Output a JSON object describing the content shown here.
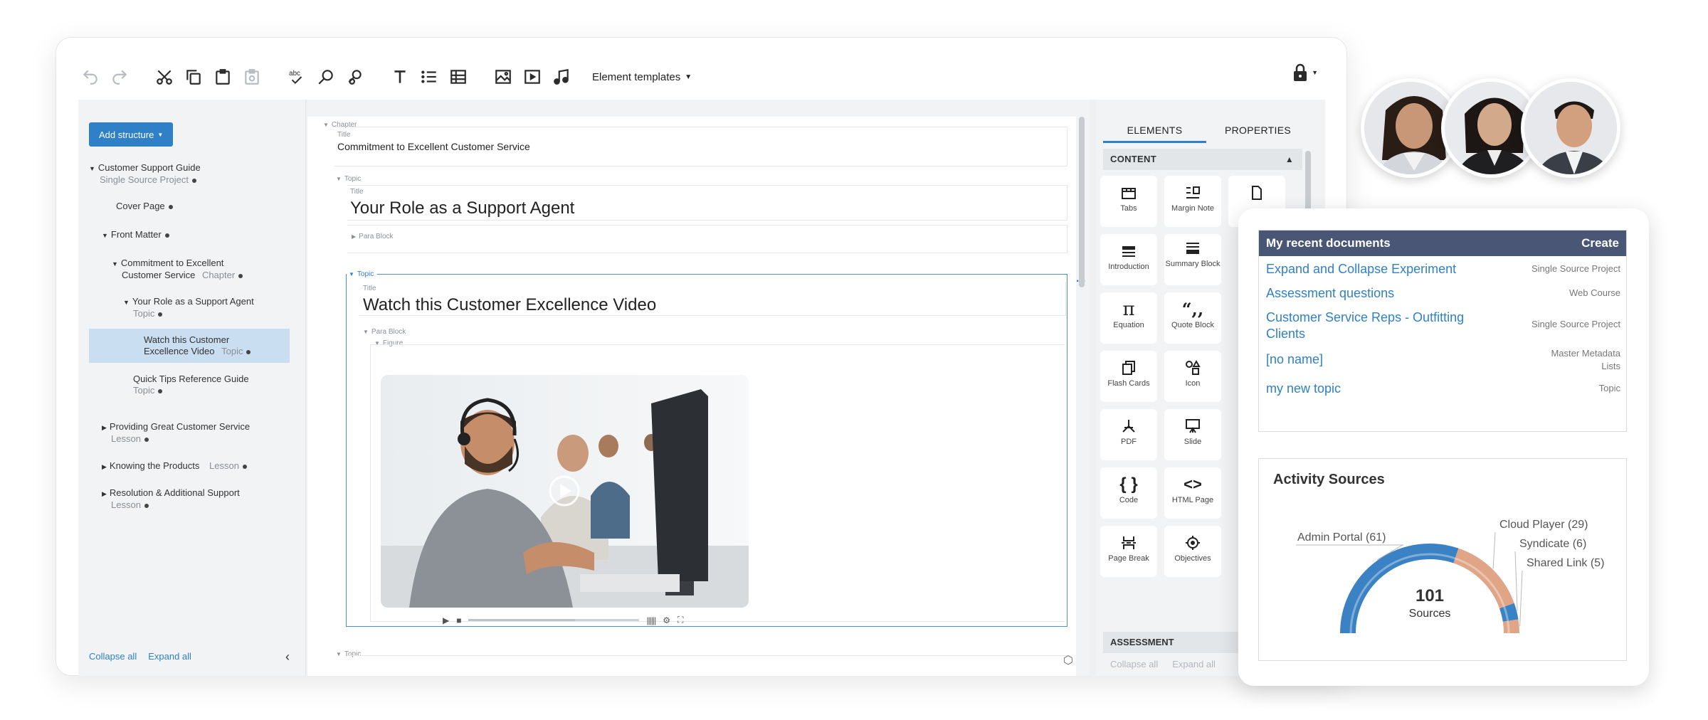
{
  "toolbar": {
    "element_templates": "Element templates"
  },
  "tree": {
    "add_structure": "Add structure",
    "items": [
      {
        "label": "Customer Support Guide",
        "type": "Single Source Project"
      },
      {
        "label": "Cover Page",
        "type": ""
      },
      {
        "label": "Front Matter",
        "type": ""
      },
      {
        "label": "Commitment to Excellent",
        "label2": "Customer Service",
        "type": "Chapter"
      },
      {
        "label": "Your Role as a Support Agent",
        "type": "Topic"
      },
      {
        "label": "Watch this Customer",
        "label2": "Excellence Video",
        "type": "Topic"
      },
      {
        "label": "Quick Tips Reference Guide",
        "type": "Topic"
      },
      {
        "label": "Providing Great Customer Service",
        "type": "Lesson"
      },
      {
        "label": "Knowing the Products",
        "type": "Lesson"
      },
      {
        "label": "Resolution & Additional Support",
        "type": "Lesson"
      }
    ],
    "collapse_all": "Collapse all",
    "expand_all": "Expand all"
  },
  "doc": {
    "chapter_label": "Chapter",
    "title_label": "Title",
    "chapter_title": "Commitment to Excellent Customer Service",
    "topic_label": "Topic",
    "topic1_title": "Your Role as a Support Agent",
    "para_block_label": "Para Block",
    "topic2_title": "Watch this Customer Excellence Video",
    "figure_label": "Figure",
    "ellipsis": "..."
  },
  "elements_panel": {
    "tabs": [
      "ELEMENTS",
      "PROPERTIES"
    ],
    "content_head": "CONTENT",
    "cards": [
      {
        "label": "Tabs",
        "icon": "tabs-icon"
      },
      {
        "label": "Margin Note",
        "icon": "margin-note-icon"
      },
      {
        "label": "Introduction",
        "icon": "introduction-icon"
      },
      {
        "label": "Summary Block",
        "icon": "summary-block-icon"
      },
      {
        "label": "Equation",
        "icon": "pi-icon",
        "glyph": "π"
      },
      {
        "label": "Quote Block",
        "icon": "quote-icon",
        "glyph": "“,,"
      },
      {
        "label": "Flash Cards",
        "icon": "flash-cards-icon"
      },
      {
        "label": "Icon",
        "icon": "shapes-icon"
      },
      {
        "label": "PDF",
        "icon": "pdf-icon"
      },
      {
        "label": "Slide",
        "icon": "slide-icon"
      },
      {
        "label": "Code",
        "icon": "braces-icon",
        "glyph": "{ }"
      },
      {
        "label": "HTML Page",
        "icon": "html-icon",
        "glyph": "<>"
      },
      {
        "label": "Page Break",
        "icon": "page-break-icon"
      },
      {
        "label": "Objectives",
        "icon": "target-icon"
      }
    ],
    "assessment_head": "ASSESSMENT",
    "collapse_all": "Collapse all",
    "expand_all": "Expand all"
  },
  "recent_docs": {
    "title": "My recent documents",
    "create": "Create",
    "rows": [
      {
        "name": "Expand and Collapse Experiment",
        "type": "Single Source Project"
      },
      {
        "name": "Assessment questions",
        "type": "Web Course"
      },
      {
        "name": "Customer Service Reps - Outfitting Clients",
        "type": "Single Source Project"
      },
      {
        "name": "[no name]",
        "type": "Master Metadata Lists"
      },
      {
        "name": "my new topic",
        "type": "Topic"
      }
    ]
  },
  "activity": {
    "title": "Activity Sources",
    "total": "101",
    "total_label": "Sources",
    "colors": {
      "admin": "#3b82c4",
      "cloud": "#e0a586",
      "syndicate": "#3b82c4",
      "shared": "#e0a586"
    }
  },
  "chart_data": {
    "type": "pie",
    "title": "Activity Sources",
    "categories": [
      "Admin Portal",
      "Cloud Player",
      "Syndicate",
      "Shared Link"
    ],
    "values": [
      61,
      29,
      6,
      5
    ],
    "labels": [
      "Admin Portal (61)",
      "Cloud Player (29)",
      "Syndicate (6)",
      "Shared Link (5)"
    ],
    "total": 101
  }
}
